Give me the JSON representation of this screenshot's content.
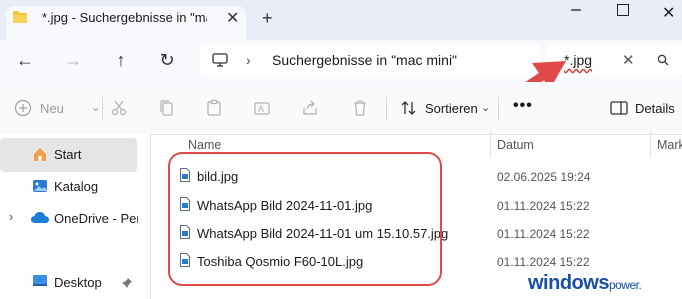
{
  "tab": {
    "title": "*.jpg - Suchergebnisse in \"mac",
    "close": "✕",
    "new_tab": "+"
  },
  "window": {
    "close": "✕"
  },
  "nav": {
    "back": "←",
    "forward": "→",
    "up": "↑",
    "refresh": "↻"
  },
  "address": {
    "chevron": "›",
    "location": "Suchergebnisse in \"mac mini\""
  },
  "search": {
    "value": "*.jpg",
    "clear": "✕"
  },
  "toolbar": {
    "new_label": "Neu",
    "new_chevron": "⌄",
    "sort_label": "Sortieren",
    "sort_chevron": "⌄",
    "more": "•••",
    "details_label": "Details"
  },
  "sidebar": {
    "items": [
      {
        "label": "Start"
      },
      {
        "label": "Katalog"
      },
      {
        "label": "OneDrive - Perso"
      },
      {
        "label": "Desktop"
      }
    ],
    "expand_chevron": "›"
  },
  "columns": {
    "name": "Name",
    "date": "Datum",
    "mark": "Mark"
  },
  "files": [
    {
      "name": "bild.jpg",
      "date": "02.06.2025 19:24"
    },
    {
      "name": "WhatsApp Bild 2024-11-01.jpg",
      "date": "01.11.2024 15:22"
    },
    {
      "name": "WhatsApp Bild 2024-11-01 um 15.10.57.jpg",
      "date": "01.11.2024 15:22"
    },
    {
      "name": "Toshiba Qosmio F60-10L.jpg",
      "date": "01.11.2024 15:22"
    }
  ],
  "watermark": {
    "main": "windows",
    "suffix": "power."
  },
  "colors": {
    "accent_red": "#e04949",
    "titlebar": "#e9eef6",
    "watermark_blue": "#1a4fa8"
  }
}
